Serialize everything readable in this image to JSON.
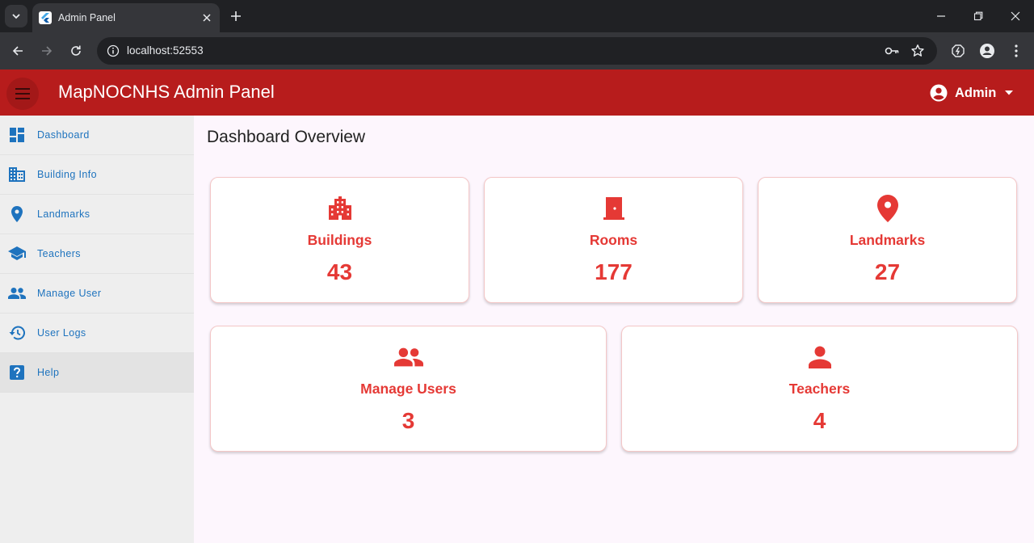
{
  "browser": {
    "tab_title": "Admin Panel",
    "url": "localhost:52553"
  },
  "appbar": {
    "title": "MapNOCNHS Admin Panel",
    "user_label": "Admin"
  },
  "sidebar": {
    "items": [
      {
        "label": "Dashboard",
        "icon": "dashboard-icon"
      },
      {
        "label": "Building Info",
        "icon": "building-icon"
      },
      {
        "label": "Landmarks",
        "icon": "location-pin-icon"
      },
      {
        "label": "Teachers",
        "icon": "school-icon"
      },
      {
        "label": "Manage User",
        "icon": "people-icon"
      },
      {
        "label": "User Logs",
        "icon": "history-icon"
      },
      {
        "label": "Help",
        "icon": "help-icon"
      }
    ]
  },
  "main": {
    "title": "Dashboard Overview",
    "cards": [
      {
        "label": "Buildings",
        "value": "43",
        "icon": "building-icon"
      },
      {
        "label": "Rooms",
        "value": "177",
        "icon": "door-icon"
      },
      {
        "label": "Landmarks",
        "value": "27",
        "icon": "location-pin-icon"
      },
      {
        "label": "Manage Users",
        "value": "3",
        "icon": "people-icon"
      },
      {
        "label": "Teachers",
        "value": "4",
        "icon": "person-icon"
      }
    ]
  },
  "colors": {
    "appbar": "#b71c1c",
    "accent": "#e53935",
    "sidebar_text": "#1e73be",
    "sidebar_bg": "#eeeeee",
    "main_bg": "#fdf6fd"
  }
}
